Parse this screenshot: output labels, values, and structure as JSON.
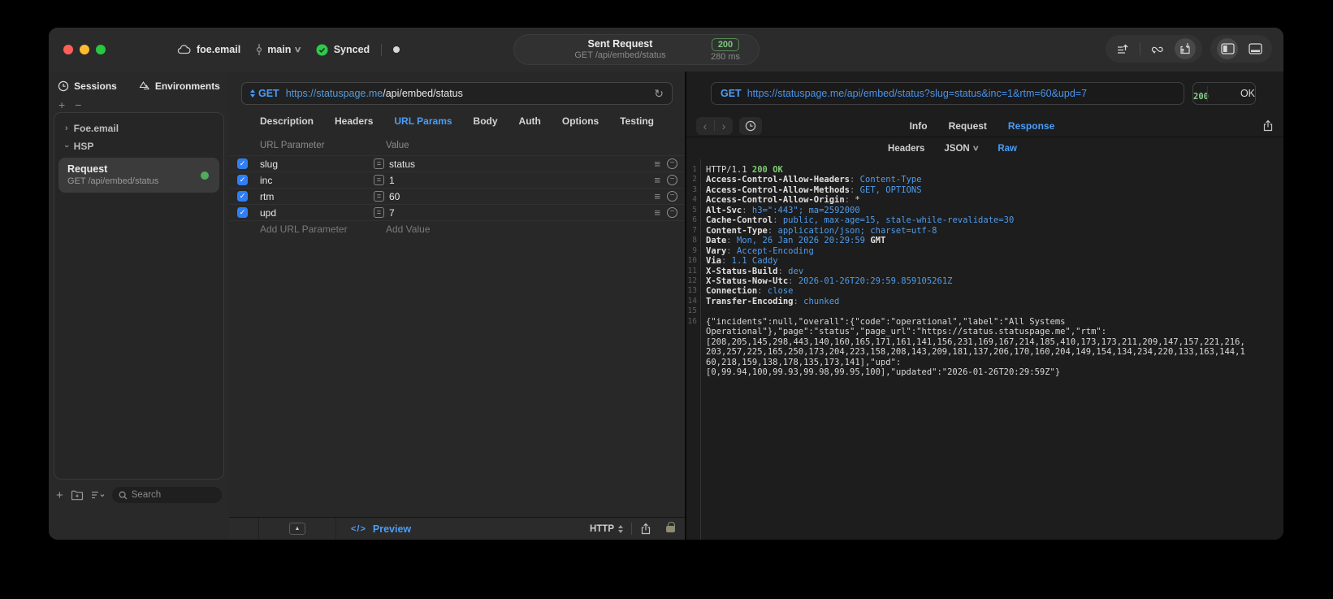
{
  "titlebar": {
    "project": "foe.email",
    "branch": "main",
    "sync_label": "Synced",
    "request_summary": {
      "title": "Sent Request",
      "method_path": "GET /api/embed/status",
      "status_code": "200",
      "duration": "280 ms"
    }
  },
  "sidebar": {
    "tabs": [
      {
        "label": "Sessions"
      },
      {
        "label": "Environments"
      }
    ],
    "tree": [
      {
        "label": "Foe.email"
      },
      {
        "label": "HSP"
      }
    ],
    "request_item": {
      "title": "Request",
      "subtitle": "GET /api/embed/status"
    },
    "search_placeholder": "Search"
  },
  "request_editor": {
    "method": "GET",
    "url_host": "https://statuspage.me",
    "url_path": "/api/embed/status",
    "tabs": [
      "Description",
      "Headers",
      "URL Params",
      "Body",
      "Auth",
      "Options",
      "Testing"
    ],
    "active_tab": "URL Params",
    "params": {
      "columns": [
        "URL Parameter",
        "Value"
      ],
      "rows": [
        {
          "enabled": true,
          "name": "slug",
          "value": "status"
        },
        {
          "enabled": true,
          "name": "inc",
          "value": "1"
        },
        {
          "enabled": true,
          "name": "rtm",
          "value": "60"
        },
        {
          "enabled": true,
          "name": "upd",
          "value": "7"
        }
      ],
      "add_parameter_label": "Add URL Parameter",
      "add_value_label": "Add Value"
    },
    "footer": {
      "preview_label": "Preview",
      "code_glyph": "</>",
      "protocol_selector": "HTTP"
    }
  },
  "response_viewer": {
    "request_line": {
      "method": "GET",
      "url": "https://statuspage.me/api/embed/status?slug=status&inc=1&rtm=60&upd=7"
    },
    "status": {
      "code": "200",
      "text": "OK"
    },
    "tabs": [
      "Info",
      "Request",
      "Response"
    ],
    "active_tab": "Response",
    "view_modes": [
      "Headers",
      "JSON",
      "Raw"
    ],
    "active_view_mode": "Raw",
    "body_lines": [
      {
        "n": "1",
        "parts": [
          {
            "c": "p",
            "t": "HTTP/1.1 "
          },
          {
            "c": "g",
            "t": "200 OK"
          }
        ]
      },
      {
        "n": "2",
        "parts": [
          {
            "c": "k",
            "t": "Access-Control-Allow-Headers"
          },
          {
            "c": "c",
            "t": ": "
          },
          {
            "c": "v",
            "t": "Content-Type"
          }
        ]
      },
      {
        "n": "3",
        "parts": [
          {
            "c": "k",
            "t": "Access-Control-Allow-Methods"
          },
          {
            "c": "c",
            "t": ": "
          },
          {
            "c": "v",
            "t": "GET, OPTIONS"
          }
        ]
      },
      {
        "n": "4",
        "parts": [
          {
            "c": "k",
            "t": "Access-Control-Allow-Origin"
          },
          {
            "c": "c",
            "t": ": "
          },
          {
            "c": "p",
            "t": "*"
          }
        ]
      },
      {
        "n": "5",
        "parts": [
          {
            "c": "k",
            "t": "Alt-Svc"
          },
          {
            "c": "c",
            "t": ": "
          },
          {
            "c": "v",
            "t": "h3=\":443\"; ma=2592000"
          }
        ]
      },
      {
        "n": "6",
        "parts": [
          {
            "c": "k",
            "t": "Cache-Control"
          },
          {
            "c": "c",
            "t": ": "
          },
          {
            "c": "v",
            "t": "public, max-age=15, stale-while-revalidate=30"
          }
        ]
      },
      {
        "n": "7",
        "parts": [
          {
            "c": "k",
            "t": "Content-Type"
          },
          {
            "c": "c",
            "t": ": "
          },
          {
            "c": "v",
            "t": "application/json; charset=utf-8"
          }
        ]
      },
      {
        "n": "8",
        "parts": [
          {
            "c": "k",
            "t": "Date"
          },
          {
            "c": "c",
            "t": ": "
          },
          {
            "c": "v",
            "t": "Mon, 26 Jan 2026 20:29:59 "
          },
          {
            "c": "k",
            "t": "GMT"
          }
        ]
      },
      {
        "n": "9",
        "parts": [
          {
            "c": "k",
            "t": "Vary"
          },
          {
            "c": "c",
            "t": ": "
          },
          {
            "c": "v",
            "t": "Accept-Encoding"
          }
        ]
      },
      {
        "n": "10",
        "parts": [
          {
            "c": "k",
            "t": "Via"
          },
          {
            "c": "c",
            "t": ": "
          },
          {
            "c": "v",
            "t": "1.1 Caddy"
          }
        ]
      },
      {
        "n": "11",
        "parts": [
          {
            "c": "k",
            "t": "X-Status-Build"
          },
          {
            "c": "c",
            "t": ": "
          },
          {
            "c": "v",
            "t": "dev"
          }
        ]
      },
      {
        "n": "12",
        "parts": [
          {
            "c": "k",
            "t": "X-Status-Now-Utc"
          },
          {
            "c": "c",
            "t": ": "
          },
          {
            "c": "v",
            "t": "2026-01-26T20:29:59.859105261Z"
          }
        ]
      },
      {
        "n": "13",
        "parts": [
          {
            "c": "k",
            "t": "Connection"
          },
          {
            "c": "c",
            "t": ": "
          },
          {
            "c": "v",
            "t": "close"
          }
        ]
      },
      {
        "n": "14",
        "parts": [
          {
            "c": "k",
            "t": "Transfer-Encoding"
          },
          {
            "c": "c",
            "t": ": "
          },
          {
            "c": "v",
            "t": "chunked"
          }
        ]
      },
      {
        "n": "15",
        "parts": []
      },
      {
        "n": "16",
        "parts": [
          {
            "c": "p",
            "t": "{\"incidents\":null,\"overall\":{\"code\":\"operational\",\"label\":\"All Systems"
          }
        ]
      },
      {
        "n": "",
        "parts": [
          {
            "c": "p",
            "t": "Operational\"},\"page\":\"status\",\"page_url\":\"https://status.statuspage.me\",\"rtm\":"
          }
        ]
      },
      {
        "n": "",
        "parts": [
          {
            "c": "p",
            "t": "[208,205,145,298,443,140,160,165,171,161,141,156,231,169,167,214,185,410,173,173,211,209,147,157,221,216,"
          }
        ]
      },
      {
        "n": "",
        "parts": [
          {
            "c": "p",
            "t": "203,257,225,165,250,173,204,223,158,208,143,209,181,137,206,170,160,204,149,154,134,234,220,133,163,144,1"
          }
        ]
      },
      {
        "n": "",
        "parts": [
          {
            "c": "p",
            "t": "60,218,159,138,178,135,173,141],\"upd\":"
          }
        ]
      },
      {
        "n": "",
        "parts": [
          {
            "c": "p",
            "t": "[0,99.94,100,99.93,99.98,99.95,100],\"updated\":\"2026-01-26T20:29:59Z\"}"
          }
        ]
      }
    ]
  },
  "colors": {
    "accent_blue": "#4a9df8",
    "code_value_blue": "#4f9ceb",
    "status_green": "#7fcb72",
    "badge_green": "#7ec97e",
    "checkbox_blue": "#2f7ef7",
    "sync_green": "#2fc94c",
    "traffic_red": "#ff5f57",
    "traffic_yellow": "#febc2e",
    "traffic_green": "#28c840"
  }
}
